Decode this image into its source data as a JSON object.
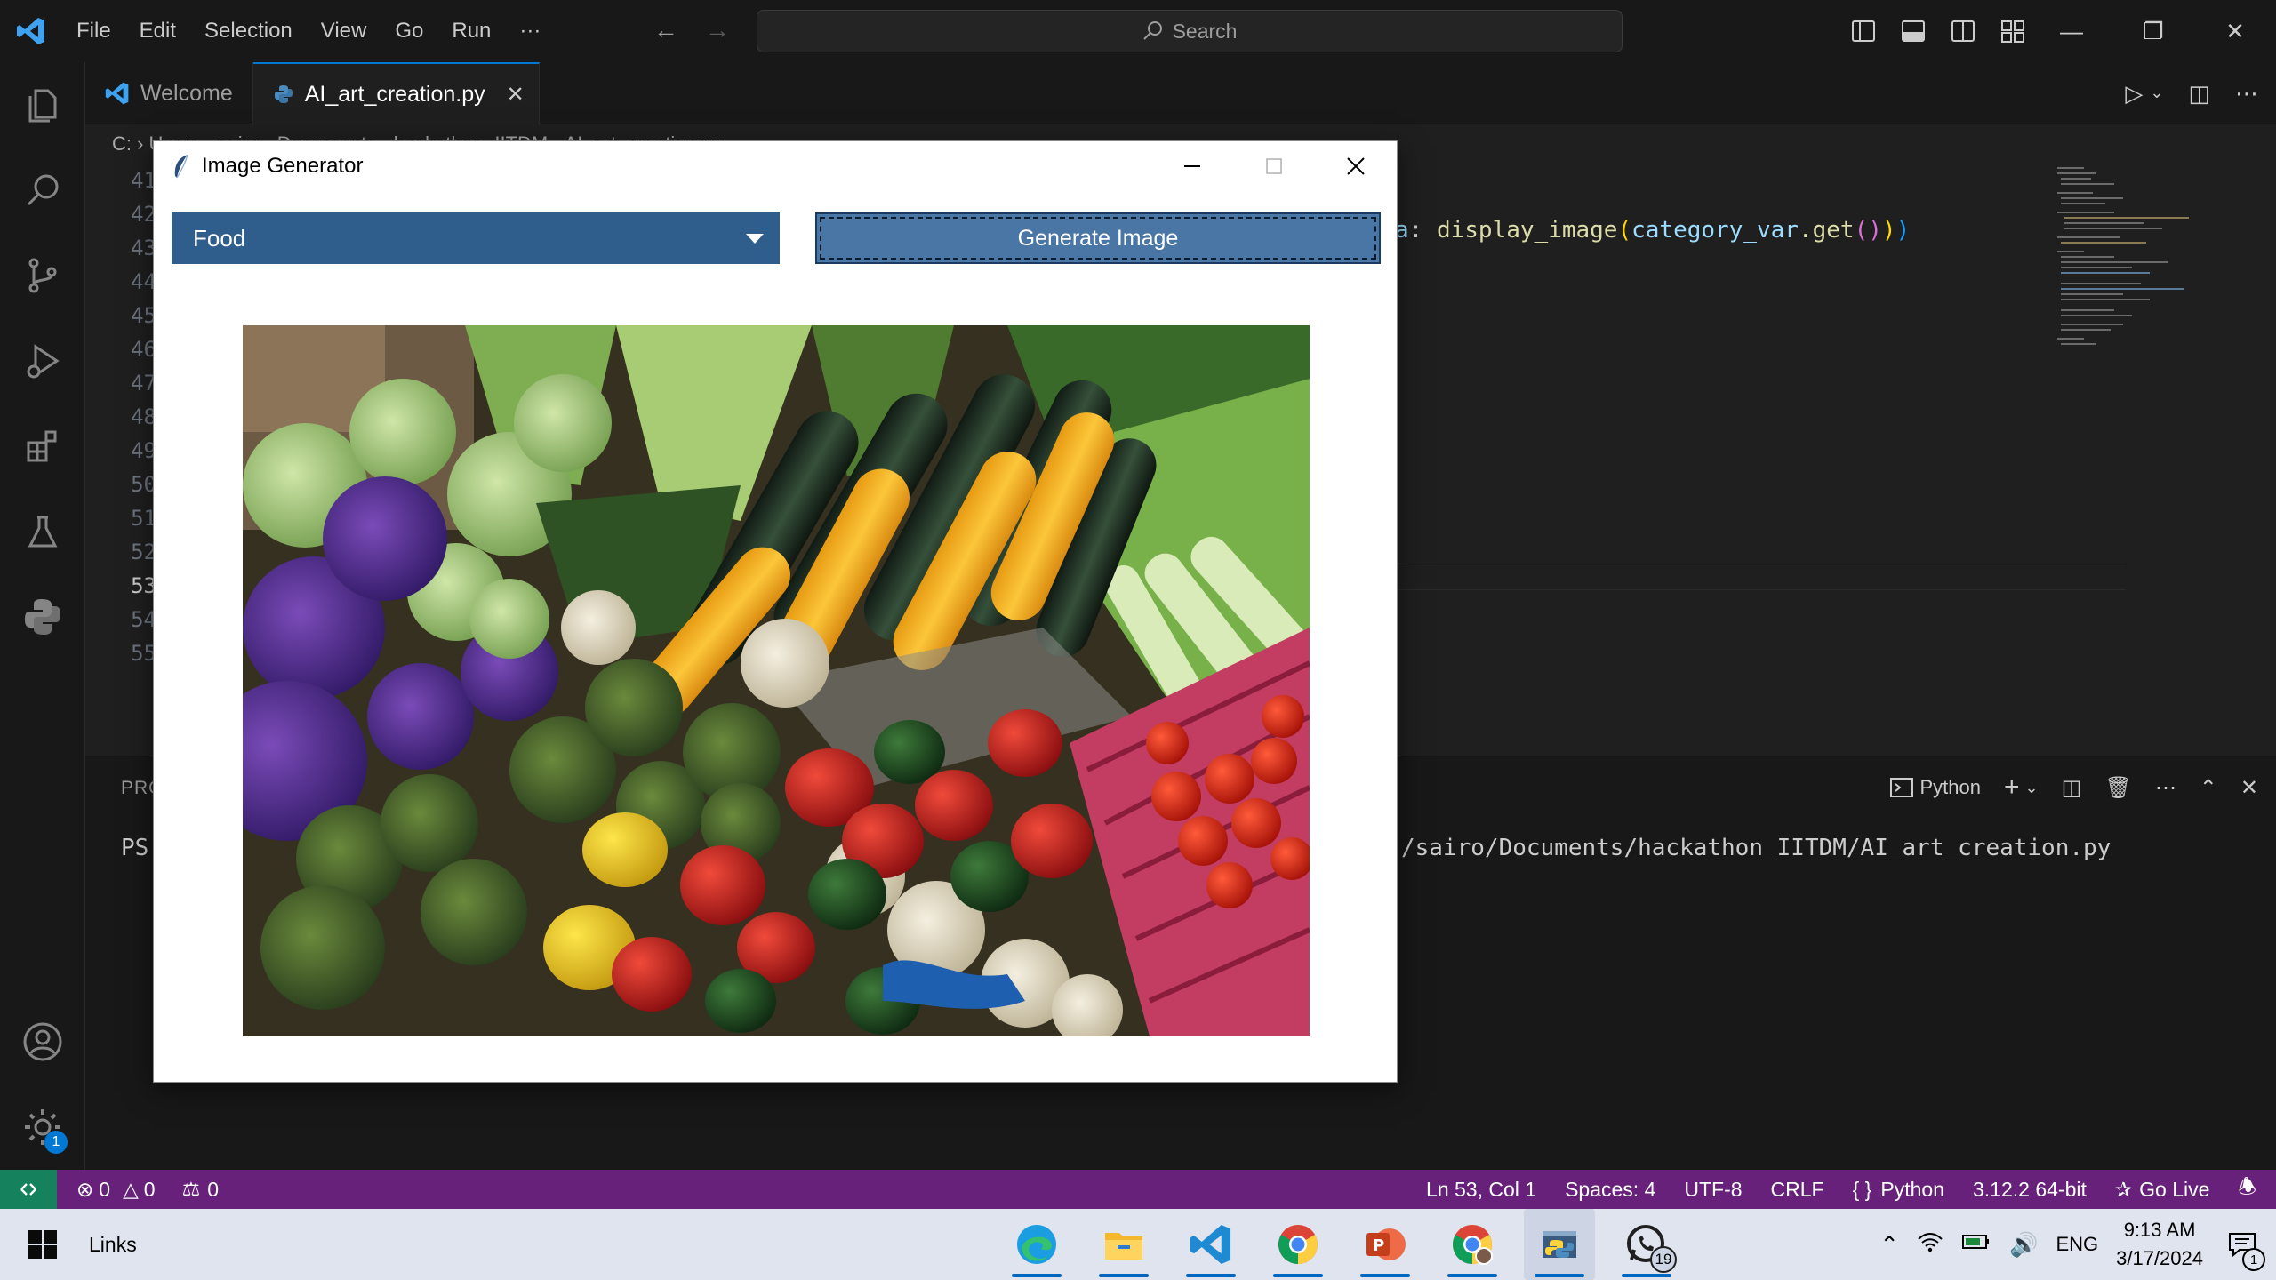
{
  "titlebar": {
    "menu": [
      "File",
      "Edit",
      "Selection",
      "View",
      "Go",
      "Run",
      "···"
    ],
    "search_placeholder": "Search"
  },
  "tabs": [
    {
      "label": "Welcome",
      "icon": "vscode-icon",
      "active": false
    },
    {
      "label": "AI_art_creation.py",
      "icon": "python-icon",
      "active": true
    }
  ],
  "breadcrumb": "C: › Users › sairo › Documents › hackathon_IITDM › AI_art_creation.py › ...",
  "editor": {
    "line_numbers": [
      "41",
      "42",
      "43",
      "44",
      "45",
      "46",
      "47",
      "48",
      "49",
      "50",
      "51",
      "52",
      "53",
      "54",
      "55"
    ],
    "current_line": "53",
    "visible_code_fragment": {
      "a": "a",
      "colon": ": ",
      "fn": "display_image",
      "arg": "category_var",
      "method": ".get",
      "close": "()))"
    }
  },
  "panel": {
    "title": "PROBLEMS",
    "prompt": "PS",
    "terminal_path": "/sairo/Documents/hackathon_IITDM/AI_art_creation.py",
    "shell": "Python"
  },
  "statusbar": {
    "errors": "0",
    "warnings": "0",
    "ports": "0",
    "position": "Ln 53, Col 1",
    "spaces": "Spaces: 4",
    "encoding": "UTF-8",
    "eol": "CRLF",
    "language": "Python",
    "interpreter": "3.12.2 64-bit",
    "golive": "Go Live"
  },
  "activity": {
    "settings_badge": "1"
  },
  "tk_window": {
    "title": "Image Generator",
    "dropdown_value": "Food",
    "button_label": "Generate Image",
    "image_subject": "market stall with vegetables"
  },
  "taskbar": {
    "links": "Links",
    "lang": "ENG",
    "time": "9:13 AM",
    "date": "3/17/2024",
    "whatsapp_badge": "19",
    "notif_badge": "1"
  },
  "colors": {
    "statusbar": "#68217a",
    "remote": "#16825d",
    "dropdown": "#2f5d8c",
    "button": "#4a76a6",
    "accent": "#0078d4"
  }
}
